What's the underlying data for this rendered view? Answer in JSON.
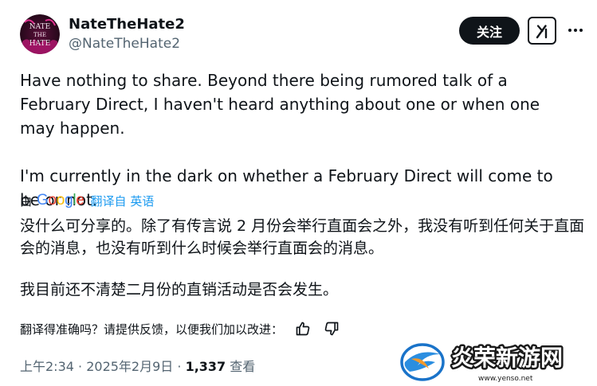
{
  "author": {
    "display_name": "NateTheHate2",
    "handle": "@NateTheHate2",
    "avatar_text_top": "NATE",
    "avatar_text_mid": "THE",
    "avatar_text_bottom": "HATE"
  },
  "actions": {
    "follow_label": "关注",
    "grok_icon": "grok-icon",
    "more_icon": "more-icon"
  },
  "tweet": {
    "paragraphs": [
      "Have nothing to share. Beyond there being rumored talk of a February Direct, I haven't heard anything about one or when one may happen.",
      "I'm currently in the dark on whether a February Direct will come to be or not."
    ]
  },
  "translation": {
    "by_label": "由",
    "provider": "Google",
    "link_label": "翻译自 英语",
    "paragraphs": [
      "没什么可分享的。除了有传言说 2 月份会举行直面会之外，我没有听到任何关于直面会的消息，也没有听到什么时候会举行直面会的消息。",
      "我目前还不清楚二月份的直销活动是否会发生。"
    ],
    "feedback_prompt": "翻译得准确吗？请提供反馈，以便我们加以改进：",
    "thumbs_up_icon": "thumbs-up-icon",
    "thumbs_down_icon": "thumbs-down-icon"
  },
  "meta": {
    "time": "上午2:34",
    "separator": " · ",
    "date": "2025年2月9日",
    "views_count": "1,337",
    "views_label": "查看"
  },
  "watermark": {
    "brand_text": "炎荣新游网",
    "url": "www.yenso.net"
  },
  "colors": {
    "text_primary": "#0f1419",
    "text_secondary": "#536471",
    "link_blue": "#1d9bf0",
    "follow_bg": "#0f1419",
    "avatar_magenta": "#c2187a"
  }
}
